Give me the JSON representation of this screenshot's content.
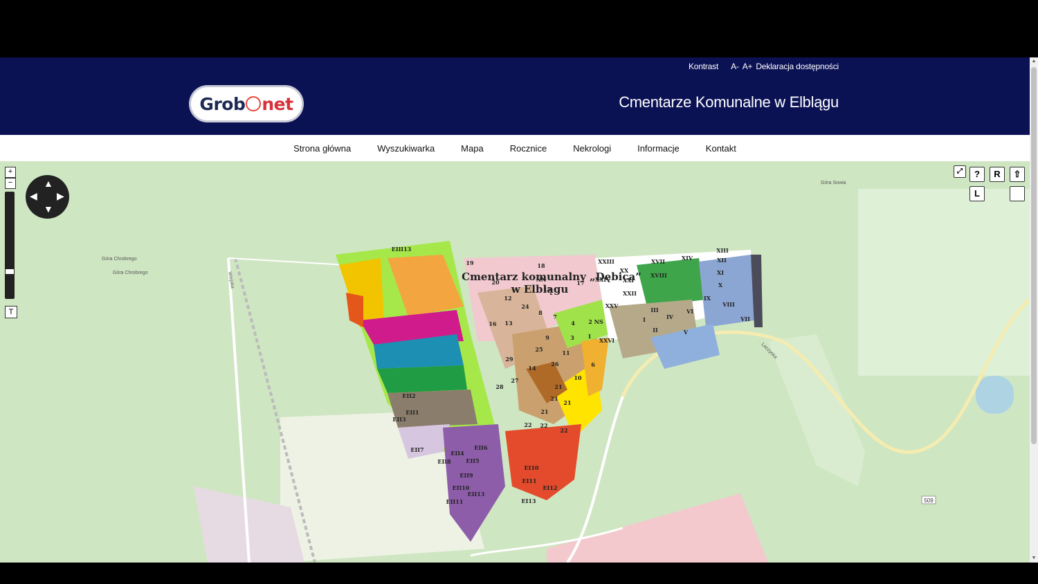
{
  "header": {
    "top_links": [
      "Kontrast",
      "A-",
      "A+",
      "Deklaracja dostępności"
    ],
    "logo": {
      "part1": "Grob",
      "part2": "net"
    },
    "title": "Cmentarze Komunalne w Elblągu"
  },
  "nav": {
    "items": [
      "Strona główna",
      "Wyszukiwarka",
      "Mapa",
      "Rocznice",
      "Nekrologi",
      "Informacje",
      "Kontakt"
    ]
  },
  "map": {
    "title_line1": "Cmentarz komunalny „Dębica”",
    "title_line2": "w Elblągu",
    "controls": {
      "zoom_in": "+",
      "zoom_out": "−",
      "t": "T",
      "help": "?",
      "r": "R",
      "l": "L"
    },
    "place_labels": [
      "Góra Chrobrego",
      "Góra Chrobrego",
      "Góra Sowia",
      "Leczycka",
      "Wiejska",
      "509"
    ],
    "section_labels": [
      "EIII13",
      "19",
      "18",
      "XXIII",
      "XVII",
      "XIV",
      "XIII",
      "XII",
      "20",
      "NN",
      "XX",
      "XXI",
      "XVIII",
      "XI",
      "X",
      "12",
      "15",
      "17",
      "XXIV",
      "XXII",
      "24",
      "XXV",
      "III",
      "IX",
      "VIII",
      "16",
      "13",
      "8",
      "7",
      "2 NS",
      "I",
      "IV",
      "VI",
      "VII",
      "9",
      "3",
      "4",
      "II",
      "V",
      "25",
      "11",
      "1",
      "XXVI",
      "29",
      "14",
      "26",
      "6",
      "27",
      "10",
      "28",
      "21",
      "21",
      "21",
      "21",
      "22",
      "22",
      "22",
      "EII1",
      "EII3",
      "EII2",
      "EII7",
      "EII4",
      "EII5",
      "EII9",
      "EII10",
      "EII11",
      "EII13",
      "EII8",
      "EII6",
      "EI10",
      "EI11",
      "EI12",
      "EI13"
    ]
  }
}
